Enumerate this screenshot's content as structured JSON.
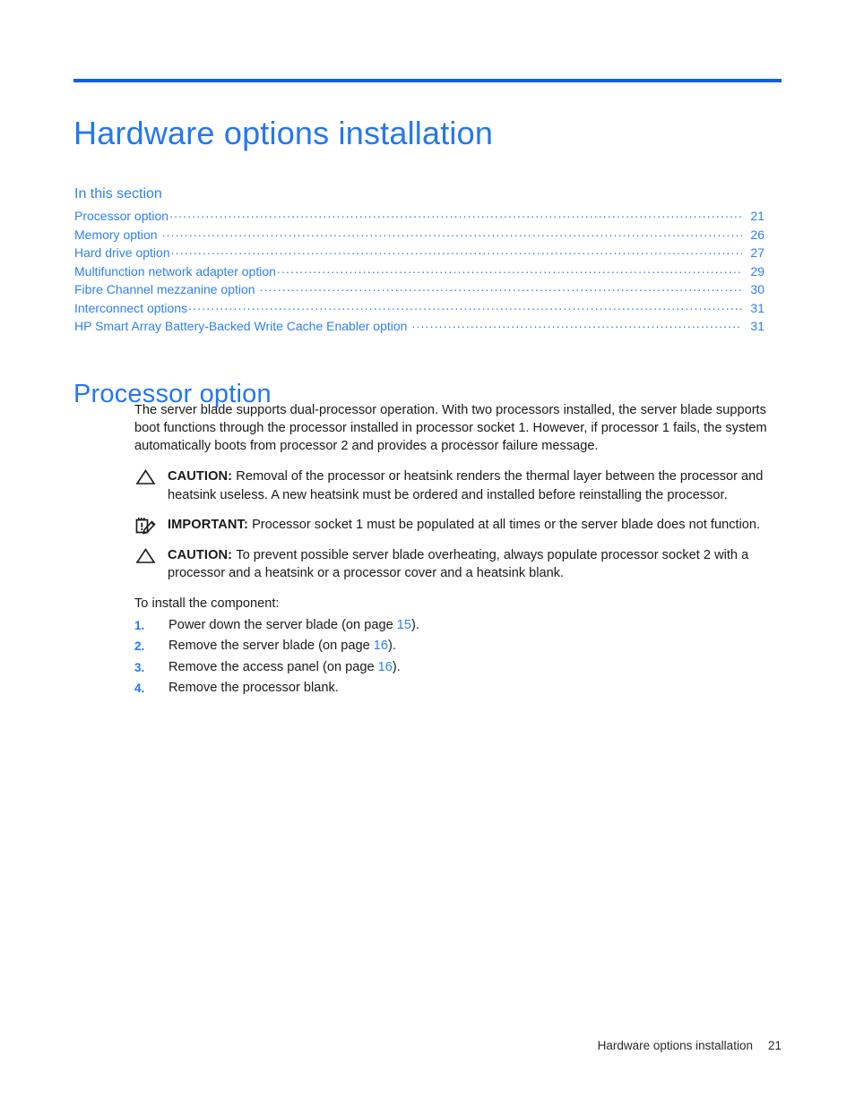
{
  "document": {
    "chapter_title": "Hardware options installation",
    "accent_blue": "#2477f2",
    "rule_blue": "#0a5fe8",
    "link_blue": "#2e80f4"
  },
  "toc": {
    "label": "In this section",
    "entries": [
      {
        "label": "Processor option",
        "page": "21",
        "space_before_dots": false
      },
      {
        "label": "Memory option",
        "page": "26",
        "space_before_dots": true
      },
      {
        "label": "Hard drive option",
        "page": "27",
        "space_before_dots": false
      },
      {
        "label": "Multifunction network adapter option",
        "page": "29",
        "space_before_dots": false
      },
      {
        "label": "Fibre Channel mezzanine option",
        "page": "30",
        "space_before_dots": true
      },
      {
        "label": "Interconnect options",
        "page": "31",
        "space_before_dots": false
      },
      {
        "label": "HP Smart Array Battery-Backed Write Cache Enabler option",
        "page": "31",
        "space_before_dots": true
      }
    ]
  },
  "section": {
    "heading": "Processor option",
    "intro_paragraph": "The server blade supports dual-processor operation. With two processors installed, the server blade supports boot functions through the processor installed in processor socket 1. However, if processor 1 fails, the system automatically boots from processor 2 and provides a processor failure message.",
    "notices": [
      {
        "icon": "warning-triangle-icon",
        "title": "CAUTION:",
        "text": "Removal of the processor or heatsink renders the thermal layer between the processor and heatsink useless. A new heatsink must be ordered and installed before reinstalling the processor."
      },
      {
        "icon": "important-note-icon",
        "title": "IMPORTANT:",
        "text": "Processor socket 1 must be populated at all times or the server blade does not function."
      },
      {
        "icon": "warning-triangle-icon",
        "title": "CAUTION:",
        "text": "To prevent possible server blade overheating, always populate processor socket 2 with a processor and a heatsink or a processor cover and a heatsink blank."
      }
    ],
    "lead_in": "To install the component:",
    "steps": [
      {
        "num": "1.",
        "before": "Power down the server blade (on page ",
        "xref": "15",
        "after": ")."
      },
      {
        "num": "2.",
        "before": "Remove the server blade (on page ",
        "xref": "16",
        "after": ")."
      },
      {
        "num": "3.",
        "before": "Remove the access panel (on page ",
        "xref": "16",
        "after": ")."
      },
      {
        "num": "4.",
        "before": "Remove the processor blank.",
        "xref": "",
        "after": ""
      }
    ]
  },
  "footer": {
    "title": "Hardware options installation",
    "page_number": "21"
  }
}
